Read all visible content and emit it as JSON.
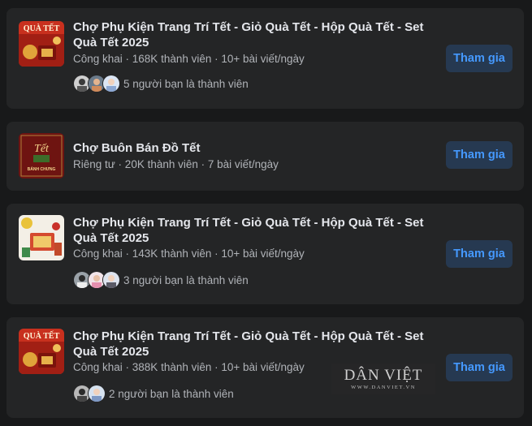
{
  "colors": {
    "background": "#18191a",
    "card": "#242526",
    "join_bg": "#263951",
    "join_text": "#4599ff"
  },
  "groups": [
    {
      "title": "Chợ Phụ Kiện Trang Trí Tết - Giỏ Quà Tết - Hộp Quà Tết - Set Quà Tết 2025",
      "meta": "Công khai · 168K thành viên · 10+ bài viết/ngày",
      "friends": "5 người bạn là thành viên",
      "thumb_text": "QUÀ TẾT",
      "join_label": "Tham gia"
    },
    {
      "title": "Chợ Buôn Bán Đồ Tết",
      "meta": "Riêng tư · 20K thành viên · 7 bài viết/ngày",
      "thumb_text": "Tết",
      "thumb_sub": "BÁNH CHƯNG",
      "join_label": "Tham gia"
    },
    {
      "title": "Chợ Phụ Kiện Trang Trí Tết - Giỏ Quà Tết - Hộp Quà Tết - Set Quà Tết 2025",
      "meta": "Công khai · 143K thành viên · 10+ bài viết/ngày",
      "friends": "3 người bạn là thành viên",
      "join_label": "Tham gia"
    },
    {
      "title": "Chợ Phụ Kiện Trang Trí Tết - Giỏ Quà Tết - Hộp Quà Tết - Set Quà Tết 2025",
      "meta": "Công khai · 388K thành viên · 10+ bài viết/ngày",
      "friends": "2 người bạn là thành viên",
      "thumb_text": "QUÀ TẾT",
      "join_label": "Tham gia"
    }
  ],
  "watermark": {
    "logo": "DÂN VIỆT",
    "url": "WWW.DANVIET.VN"
  }
}
